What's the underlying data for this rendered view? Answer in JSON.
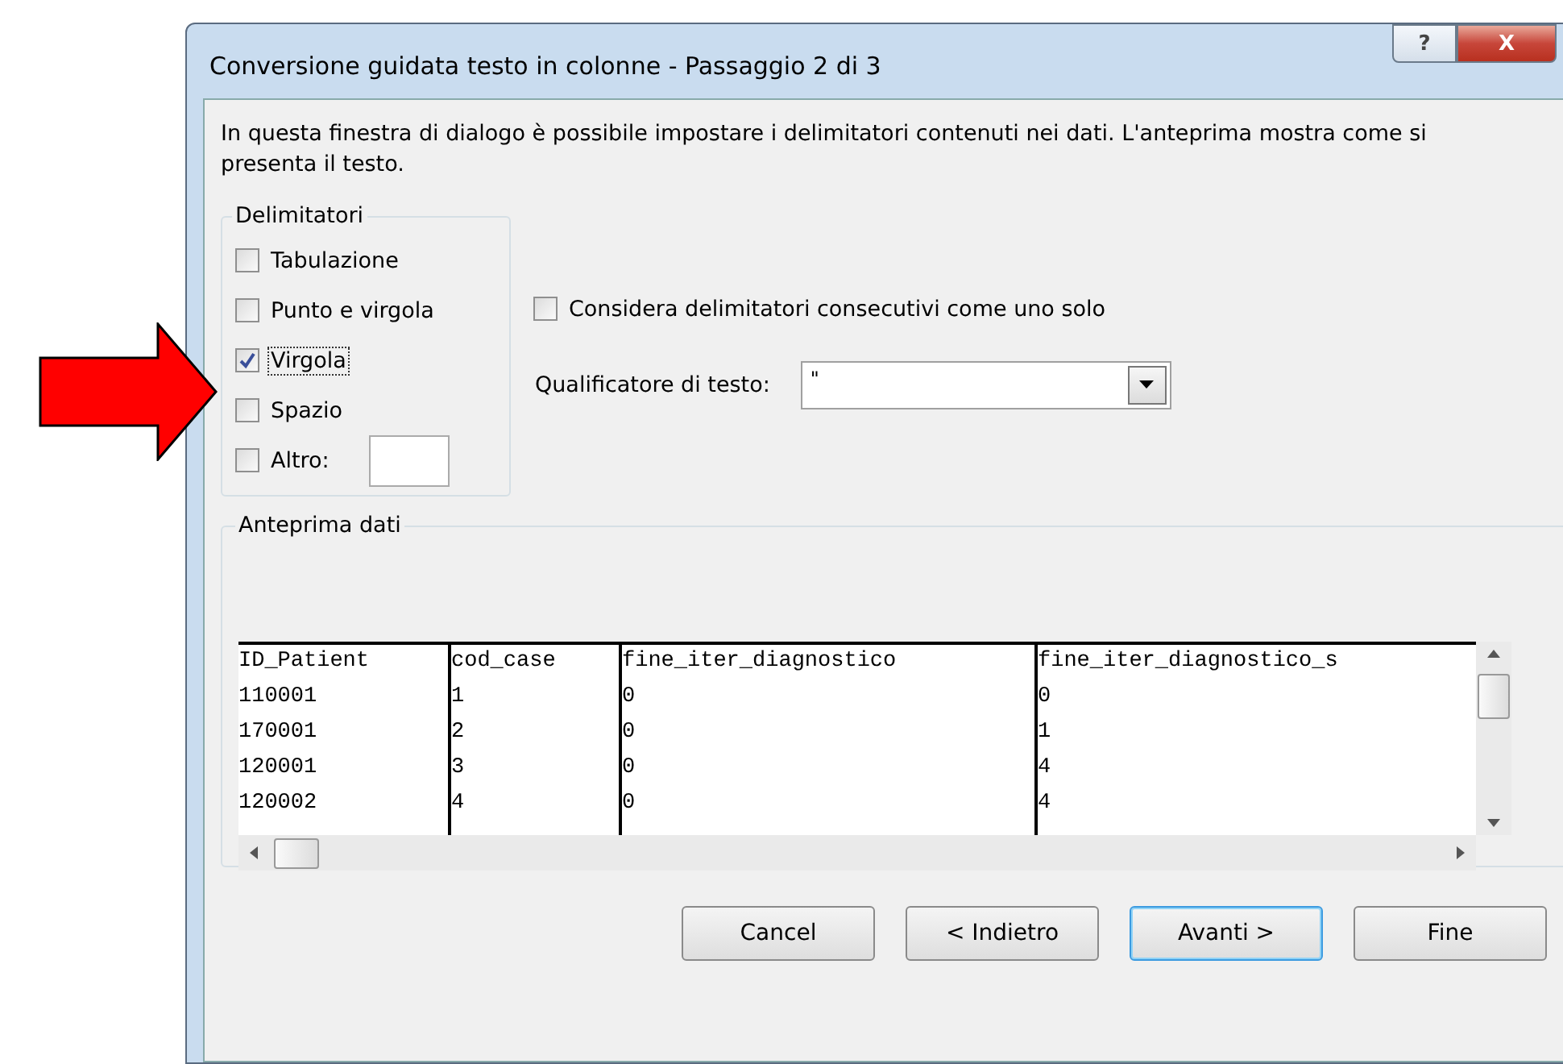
{
  "window": {
    "title": "Conversione guidata testo in colonne - Passaggio 2 di 3",
    "help_button": "?",
    "close_button": "X"
  },
  "intro": "In questa finestra di dialogo è possibile impostare i delimitatori contenuti nei dati. L'anteprima mostra come si presenta il testo.",
  "delimiters": {
    "title": "Delimitatori",
    "items": [
      {
        "label": "Tabulazione",
        "checked": false,
        "focused": false
      },
      {
        "label": "Punto e virgola",
        "checked": false,
        "focused": false
      },
      {
        "label": "Virgola",
        "checked": true,
        "focused": true
      },
      {
        "label": "Spazio",
        "checked": false,
        "focused": false
      },
      {
        "label": "Altro:",
        "checked": false,
        "focused": false,
        "kind": "input"
      }
    ]
  },
  "consecutive": {
    "label": "Considera delimitatori consecutivi come uno solo",
    "checked": false
  },
  "text_qualifier": {
    "label": "Qualificatore di testo:",
    "value": "\""
  },
  "preview": {
    "title": "Anteprima dati",
    "columns": [
      "ID_Patient",
      "cod_case",
      "fine_iter_diagnostico",
      "fine_iter_diagnostico_s"
    ],
    "rows": [
      [
        "110001",
        "1",
        "0",
        "0"
      ],
      [
        "170001",
        "2",
        "0",
        "1"
      ],
      [
        "120001",
        "3",
        "0",
        "4"
      ],
      [
        "120002",
        "4",
        "0",
        "4"
      ]
    ]
  },
  "buttons": [
    {
      "label": "Cancel",
      "default": false
    },
    {
      "label": "< Indietro",
      "default": false
    },
    {
      "label": "Avanti >",
      "default": true
    },
    {
      "label": "Fine",
      "default": false
    }
  ]
}
